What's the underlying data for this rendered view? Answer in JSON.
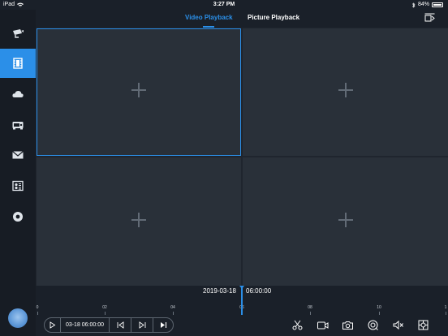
{
  "status_bar": {
    "device": "iPad",
    "time": "3:27 PM",
    "battery": "84%"
  },
  "tabs": {
    "video": "Video Playback",
    "picture": "Picture Playback"
  },
  "sidebar": {
    "items": [
      {
        "name": "camera-icon",
        "active": false
      },
      {
        "name": "playback-film-icon",
        "active": true
      },
      {
        "name": "cloud-icon",
        "active": false
      },
      {
        "name": "device-icon",
        "active": false
      },
      {
        "name": "mail-icon",
        "active": false
      },
      {
        "name": "control-panel-icon",
        "active": false
      },
      {
        "name": "eye-icon",
        "active": false
      }
    ]
  },
  "timeline": {
    "date": "2019-03-18",
    "time": "06:00:00",
    "ticks": [
      "0",
      "02",
      "04",
      "06",
      "08",
      "10",
      "1"
    ]
  },
  "controls": {
    "time_label": "03-18 06:00:00",
    "icons": [
      "play-icon",
      "step-back-icon",
      "step-forward-icon",
      "skip-end-icon",
      "scissors-icon",
      "record-icon",
      "snapshot-icon",
      "fisheye-icon",
      "mute-icon",
      "settings-icon"
    ]
  },
  "colors": {
    "accent": "#2b8fe8",
    "background": "#1a2029",
    "cell": "#293039"
  }
}
